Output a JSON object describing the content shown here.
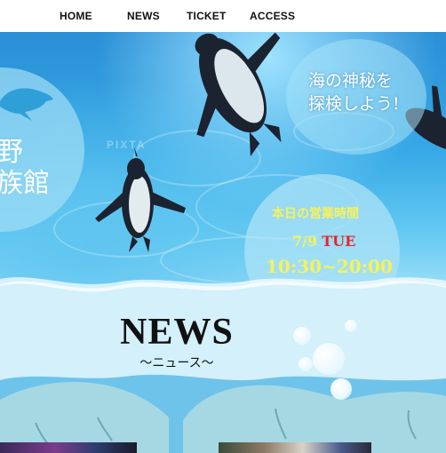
{
  "nav": {
    "items": [
      "HOME",
      "NEWS",
      "TICKET",
      "ACCESS"
    ]
  },
  "hero": {
    "title_partial_line1": "野",
    "title_partial_line2": "族館",
    "tagline_line1": "海の神秘を",
    "tagline_line2": "探検しよう!",
    "watermark": "PIXTA",
    "hours": {
      "heading": "本日の営業時間",
      "date": "7/9",
      "weekday": "TUE",
      "time": "10:30~20:00"
    }
  },
  "news": {
    "title": "NEWS",
    "subtitle": "〜ニュース〜"
  },
  "colors": {
    "nav_bg": "#ffffff",
    "hours_yellow": "#f7f25a",
    "weekday_red": "#e4262a",
    "tagline_color": "#ffffff",
    "news_bg": "#cfeefa",
    "wave_blue": "#6ec3ea"
  }
}
